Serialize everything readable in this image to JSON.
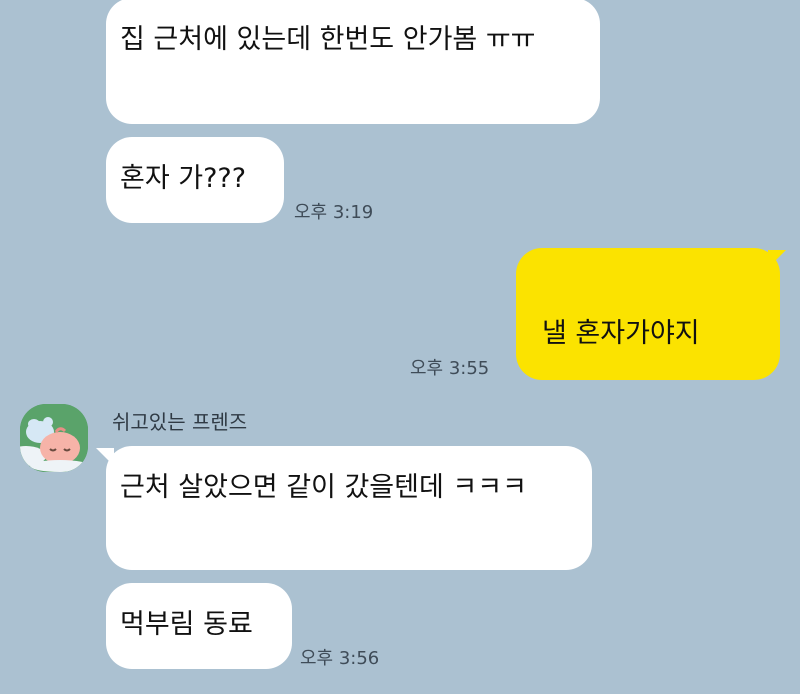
{
  "messages": [
    {
      "text": "집 근처에 있는데 한번도 안가봄 ㅠㅠ"
    },
    {
      "text": "혼자 가???",
      "time": "오후 3:19"
    },
    {
      "text": "낼 혼자가야지",
      "time": "오후 3:55"
    },
    {
      "text": "근처 살았으면 같이 갔을텐데 ㅋㅋㅋ"
    },
    {
      "text": "먹부림 동료",
      "time": "오후 3:56"
    }
  ],
  "sender": {
    "name": "쉬고있는 프렌즈",
    "avatar_icon": "sleeping-peach-character-icon"
  },
  "colors": {
    "background": "#abc1d1",
    "incoming_bubble": "#ffffff",
    "outgoing_bubble": "#fbe300"
  }
}
